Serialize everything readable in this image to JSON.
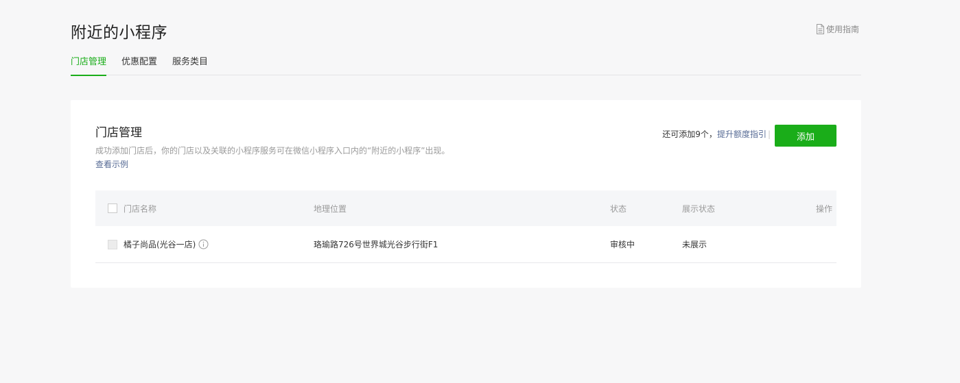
{
  "page": {
    "title": "附近的小程序",
    "guide_label": "使用指南"
  },
  "tabs": [
    {
      "label": "门店管理",
      "active": true
    },
    {
      "label": "优惠配置",
      "active": false
    },
    {
      "label": "服务类目",
      "active": false
    }
  ],
  "card": {
    "title": "门店管理",
    "description": "成功添加门店后，你的门店以及关联的小程序服务可在微信小程序入口内的“附近的小程序”出现。",
    "example_link": "查看示例",
    "quota_text": "还可添加9个，",
    "upgrade_link": "提升额度指引",
    "add_button": "添加"
  },
  "table": {
    "headers": {
      "name": "门店名称",
      "address": "地理位置",
      "status": "状态",
      "display_status": "展示状态",
      "operation": "操作"
    },
    "rows": [
      {
        "name": "橘子尚品(光谷一店)",
        "address": "珞瑜路726号世界城光谷步行街F1",
        "status": "审核中",
        "display_status": "未展示",
        "operation": ""
      }
    ]
  },
  "colors": {
    "accent": "#1aad19",
    "link": "#576b95",
    "background": "#f7f7f8"
  },
  "icons": {
    "guide": "document-icon",
    "info": "info-icon"
  }
}
